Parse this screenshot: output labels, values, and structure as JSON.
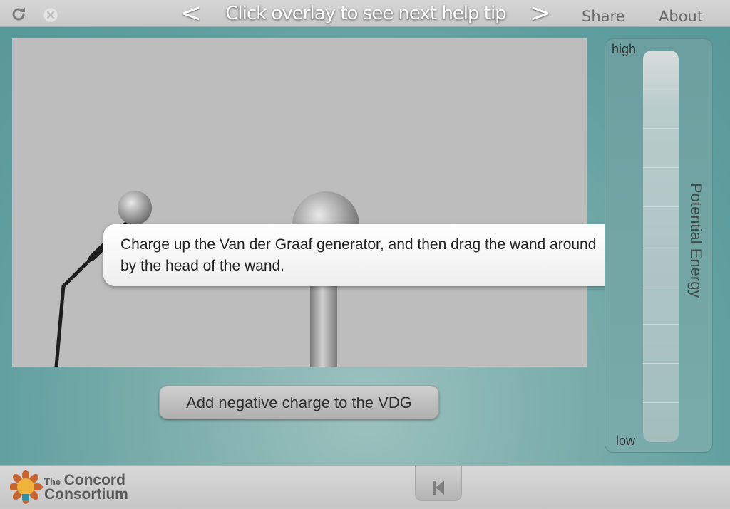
{
  "topbar": {
    "reload_icon": "reload-icon",
    "close_icon": "close-icon",
    "prev_label": "<",
    "help_tip_title": "Click overlay to see next help tip",
    "next_label": ">",
    "share_label": "Share",
    "about_label": "About"
  },
  "simulation": {
    "help_tip_text": "Charge up the Van der Graaf generator, and then drag the wand around by the head of the wand.",
    "charge_button_label": "Add negative charge to the VDG"
  },
  "energy_meter": {
    "title": "Potential Energy",
    "high_label": "high",
    "low_label": "low"
  },
  "footer": {
    "logo_the": "The",
    "logo_line1": "Concord",
    "logo_line2": "Consortium",
    "rewind_icon": "rewind-icon"
  },
  "colors": {
    "background": "#62a0a0",
    "canvas": "#bdbdbd",
    "bar": "#cfcfcf"
  }
}
